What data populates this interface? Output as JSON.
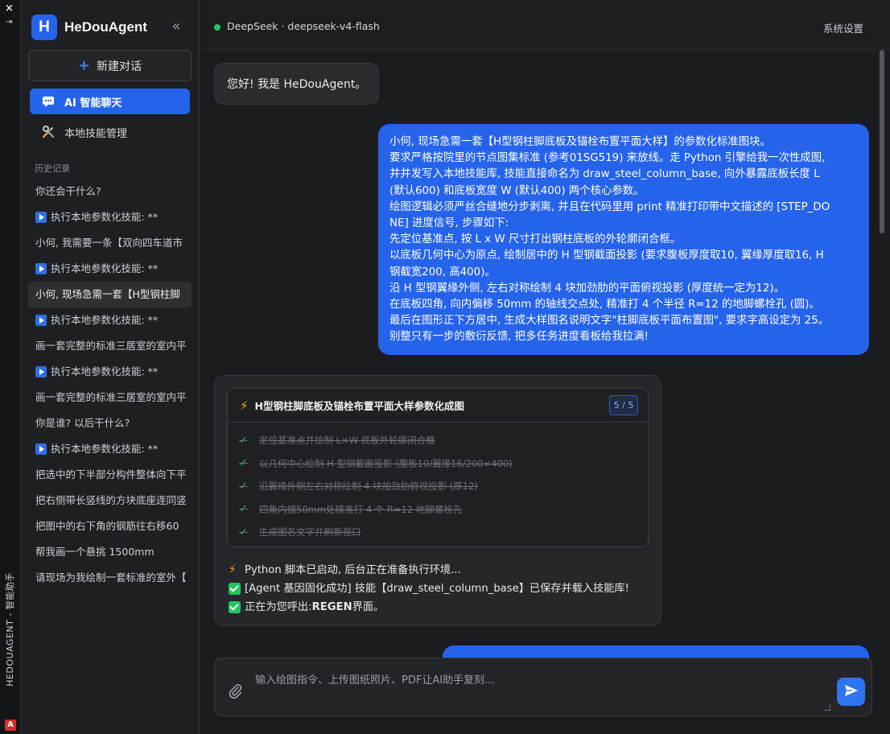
{
  "window": {
    "close_glyph": "×",
    "pin_glyph": "⇥",
    "vertical_label": "HEDOUAGENT - 智能助手",
    "logo_letter": "A"
  },
  "sidebar": {
    "brand_letter": "H",
    "brand_name": "HeDouAgent",
    "collapse_glyph": "«",
    "new_chat_plus": "+",
    "new_chat_label": "新建对话",
    "nav": [
      {
        "label": "AI 智能聊天",
        "icon": "chat-icon",
        "active": true
      },
      {
        "label": "本地技能管理",
        "icon": "tools-icon",
        "active": false
      }
    ],
    "history_label": "历史记录",
    "history": [
      {
        "text": "你还会干什么?",
        "play": false
      },
      {
        "text": "执行本地参数化技能: **",
        "play": true
      },
      {
        "text": "小何, 我需要一条【双向四车道市",
        "play": false
      },
      {
        "text": "执行本地参数化技能: **",
        "play": true
      },
      {
        "text": "小何, 现场急需一套【H型钢柱脚",
        "play": false,
        "active": true
      },
      {
        "text": "执行本地参数化技能: **",
        "play": true
      },
      {
        "text": "画一套完整的标准三居室的室内平",
        "play": false
      },
      {
        "text": "执行本地参数化技能: **",
        "play": true
      },
      {
        "text": "画一套完整的标准三居室的室内平",
        "play": false
      },
      {
        "text": "你是谁? 以后干什么?",
        "play": false
      },
      {
        "text": "执行本地参数化技能: **",
        "play": true
      },
      {
        "text": "把选中的下半部分构件整体向下平",
        "play": false
      },
      {
        "text": "把右侧带长竖线的方块底座连同竖",
        "play": false
      },
      {
        "text": "把图中的右下角的钢筋往右移60",
        "play": false
      },
      {
        "text": "帮我画一个悬挑 1500mm",
        "play": false
      },
      {
        "text": "请现场为我绘制一套标准的室外【",
        "play": false
      }
    ]
  },
  "topbar": {
    "model": "DeepSeek · deepseek-v4-flash",
    "status_color": "#22c55e",
    "settings": "系统设置"
  },
  "chat": {
    "greeting": "您好! 我是 HeDouAgent。",
    "user_message_lines": [
      "小何, 现场急需一套【H型钢柱脚底板及锚栓布置平面大样】的参数化标准图块。",
      "要求严格按院里的节点图集标准 (参考01SG519) 来放线。走 Python 引擎给我一次性成图,",
      "并并发写入本地技能库, 技能直接命名为 draw_steel_column_base, 向外暴露底板长度 L",
      "(默认600) 和底板宽度 W (默认400) 两个核心参数。",
      "绘图逻辑必须严丝合缝地分步剥离, 并且在代码里用 print 精准打印带中文描述的 [STEP_DO",
      "NE] 进度信号, 步骤如下:",
      "先定位基准点, 按 L x W 尺寸打出钢柱底板的外轮廓闭合框。",
      "以底板几何中心为原点, 绘制居中的 H 型钢截面投影 (要求腹板厚度取10, 翼缘厚度取16, H",
      "钢截宽200, 高400)。",
      "沿 H 型钢翼缘外侧, 左右对称绘制 4 块加劲肋的平面俯视投影 (厚度统一定为12)。",
      "在底板四角, 向内偏移 50mm 的轴线交点处, 精准打 4 个半径 R=12 的地脚螺栓孔 (圆)。",
      "最后在图形正下方居中, 生成大样图名说明文字\"柱脚底板平面布置图\", 要求字高设定为 25。",
      "别整只有一步的敷衍反馈, 把多任务进度看板给我拉满!"
    ],
    "task": {
      "title": "H型钢柱脚底板及锚栓布置平面大样参数化成图",
      "progress": "5 / 5",
      "steps": [
        "定位基准点并绘制 L×W 底板外轮廓闭合框",
        "以几何中心绘制 H 型钢截面投影 (腹板10/翼缘16/200×400)",
        "沿翼缘外侧左右对称绘制 4 块加劲肋俯视投影 (厚12)",
        "四角内缩50mm处精准打 4 个 R=12 地脚螺栓孔",
        "生成图名文字并刷新视口"
      ],
      "status": [
        {
          "type": "bolt",
          "text": "Python 脚本已启动, 后台正在准备执行环境..."
        },
        {
          "type": "check",
          "text": "[Agent 基因固化成功] 技能【draw_steel_column_base】已保存并载入技能库!"
        },
        {
          "type": "check",
          "prefix": "正在为您呼出: ",
          "bold": "REGEN",
          "suffix": " 界面。"
        }
      ]
    }
  },
  "composer": {
    "placeholder": "输入绘图指令、上传图纸照片、PDF让AI助手复刻...",
    "accent": "#2f74f0"
  }
}
